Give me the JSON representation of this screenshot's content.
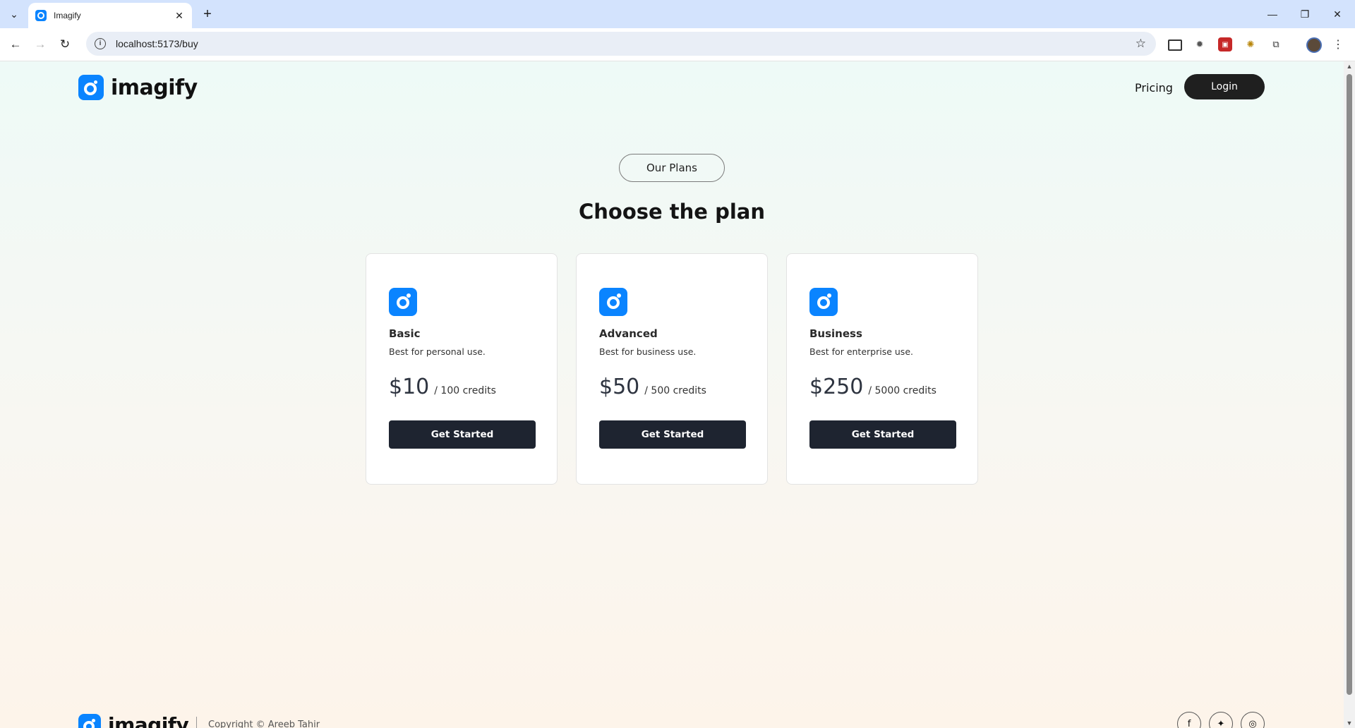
{
  "browser": {
    "tab_title": "Imagify",
    "tab_close": "✕",
    "new_tab": "+",
    "url": "localhost:5173/buy",
    "minimize": "—",
    "restore": "❐",
    "close": "✕"
  },
  "header": {
    "logo_text": "imagify",
    "nav_pricing": "Pricing",
    "login_label": "Login"
  },
  "hero": {
    "pill_label": "Our Plans",
    "headline": "Choose the plan"
  },
  "plans": [
    {
      "name": "Basic",
      "desc": "Best for personal use.",
      "price": "$10",
      "credits": "/ 100 credits",
      "cta": "Get Started"
    },
    {
      "name": "Advanced",
      "desc": "Best for business use.",
      "price": "$50",
      "credits": "/ 500 credits",
      "cta": "Get Started"
    },
    {
      "name": "Business",
      "desc": "Best for enterprise use.",
      "price": "$250",
      "credits": "/ 5000 credits",
      "cta": "Get Started"
    }
  ],
  "footer": {
    "logo_text": "imagify",
    "copyright": "Copyright © Areeb Tahir"
  },
  "colors": {
    "brand": "#0a84ff",
    "dark": "#1e2430",
    "tabbar": "#d3e3fd"
  }
}
